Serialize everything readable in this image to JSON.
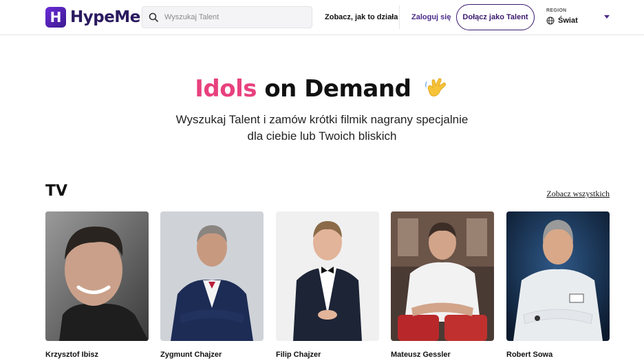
{
  "header": {
    "logo_text": "HypeMe",
    "logo_letter": "H",
    "search": {
      "placeholder": "Wyszukaj Talent"
    },
    "nav": {
      "how_it_works": "Zobacz, jak to działa",
      "login": "Zaloguj się",
      "join": "Dołącz jako Talent"
    },
    "region": {
      "label": "REGION",
      "value": "Świat"
    }
  },
  "hero": {
    "title_highlight": "Idols",
    "title_rest": "on Demand",
    "subtitle_line1": "Wyszukaj Talent i zamów krótki filmik nagrany specjalnie",
    "subtitle_line2": "dla ciebie lub Twoich bliskich"
  },
  "section": {
    "title": "TV",
    "see_all": "Zobacz wszystkich",
    "talents": [
      {
        "name": "Krzysztof Ibisz"
      },
      {
        "name": "Zygmunt Chajzer"
      },
      {
        "name": "Filip Chajzer"
      },
      {
        "name": "Mateusz Gessler"
      },
      {
        "name": "Robert Sowa"
      }
    ]
  },
  "colors": {
    "accent_pink": "#e8417e",
    "brand_purple": "#3b1a6e"
  },
  "icons": [
    "search-icon",
    "globe-icon",
    "chevron-down-icon",
    "hand-emoji-icon"
  ]
}
